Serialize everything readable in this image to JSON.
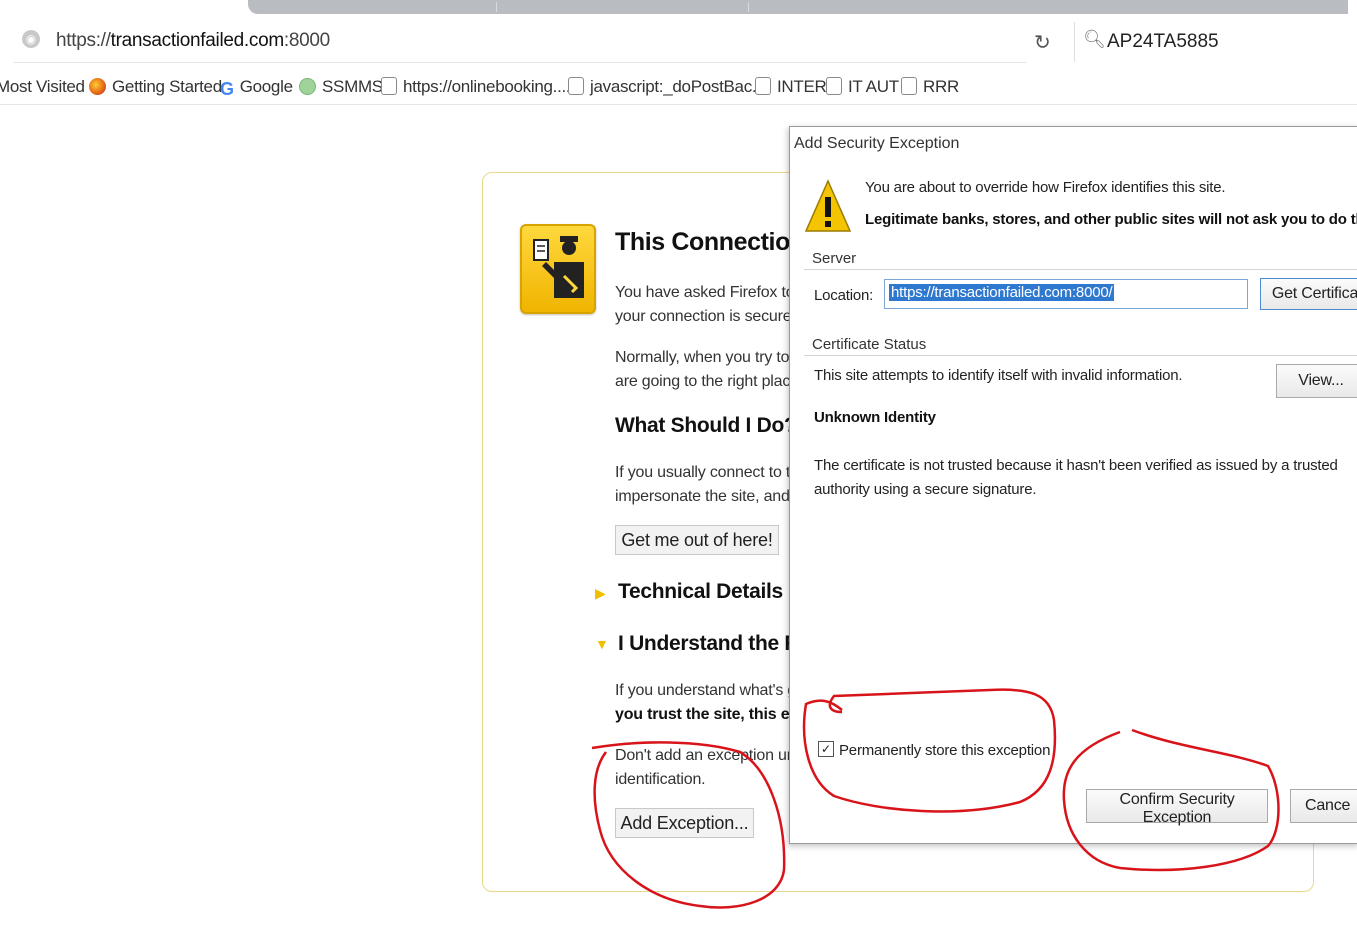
{
  "browser": {
    "url_prefix": "https://",
    "url_host": "transactionfailed.com",
    "url_port": ":8000",
    "search_text": "AP24TA5885"
  },
  "bookmarks": [
    {
      "label": "Most Visited",
      "icon": "none"
    },
    {
      "label": "Getting Started",
      "icon": "firefox-icon"
    },
    {
      "label": "Google",
      "icon": "google-icon"
    },
    {
      "label": "SSMMS",
      "icon": "globe-icon"
    },
    {
      "label": "https://onlinebooking....",
      "icon": "page-icon"
    },
    {
      "label": "javascript:_doPostBac...",
      "icon": "page-icon"
    },
    {
      "label": "INTER",
      "icon": "page-icon"
    },
    {
      "label": "IT AUT",
      "icon": "page-icon"
    },
    {
      "label": "RRR",
      "icon": "page-icon"
    }
  ],
  "error_page": {
    "title": "This Connection",
    "para1_line1": "You have asked Firefox to c",
    "para1_line2": "your connection is secure.",
    "para2_line1": "Normally, when you try to c",
    "para2_line2": "are going to the right place",
    "what_should_heading": "What Should I Do?",
    "para3_line1": "If you usually connect to thi",
    "para3_line2": "impersonate the site, and y",
    "get_out_button": "Get me out of here!",
    "technical_details": "Technical Details",
    "understand_risks": "I Understand the Ri",
    "para4_line1": "If you understand what's go",
    "para4_line2": "you trust the site, this erro",
    "para5_line1": "Don't add an exception unl",
    "para5_line2": "identification.",
    "add_exception_button": "Add Exception..."
  },
  "dialog": {
    "title": "Add Security Exception",
    "warning_line1": "You are about to override how Firefox identifies this site.",
    "warning_line2": "Legitimate banks, stores, and other public sites will not ask you to do th",
    "server_label": "Server",
    "location_label": "Location:",
    "location_value": "https://transactionfailed.com:8000/",
    "get_certificate_button": "Get Certifica",
    "cert_status_label": "Certificate Status",
    "cert_status_text": "This site attempts to identify itself with invalid information.",
    "view_button": "View...",
    "unknown_identity": "Unknown Identity",
    "unknown_line1": "The certificate is not trusted because it hasn't been verified as issued by a trusted",
    "unknown_line2": "authority using a secure signature.",
    "permanently_store_label": "Permanently store this exception",
    "permanently_store_checked": true,
    "confirm_button": "Confirm Security Exception",
    "cancel_button": "Cance"
  },
  "colors": {
    "annotation_ink": "#d8141a",
    "selection": "#2f78d0",
    "warning_yellow": "#f5c400"
  }
}
